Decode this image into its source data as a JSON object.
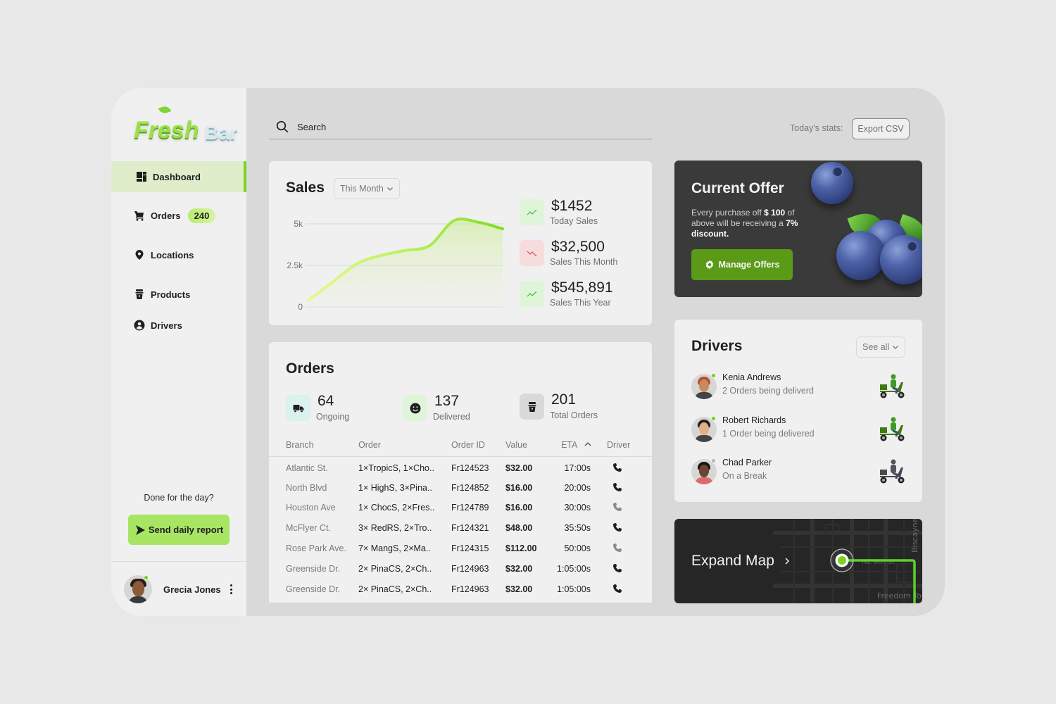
{
  "brand": {
    "name_part1": "Fresh",
    "name_part2": "Bar"
  },
  "sidebar": {
    "items": [
      {
        "label": "Dashboard",
        "icon": "dashboard-icon",
        "active": true
      },
      {
        "label": "Orders",
        "icon": "cart-icon",
        "badge": "240"
      },
      {
        "label": "Locations",
        "icon": "location-pin-icon"
      },
      {
        "label": "Products",
        "icon": "cup-icon"
      },
      {
        "label": "Drivers",
        "icon": "user-circle-icon"
      }
    ],
    "done_prompt": "Done for the day?",
    "send_report_label": "Send daily report",
    "user": {
      "name": "Grecia Jones",
      "status": "online"
    }
  },
  "topbar": {
    "search_placeholder": "Search",
    "stats_label": "Today's stats:",
    "export_label": "Export CSV"
  },
  "sales": {
    "title": "Sales",
    "period": "This Month",
    "kpis": [
      {
        "value": "$1452",
        "label": "Today Sales",
        "trend": "up"
      },
      {
        "value": "$32,500",
        "label": "Sales This Month",
        "trend": "down"
      },
      {
        "value": "$545,891",
        "label": "Sales This Year",
        "trend": "up"
      }
    ],
    "colors": {
      "up_bg": "#dff5d9",
      "up_line": "#3dbb3d",
      "down_bg": "#f6dcdc",
      "down_line": "#d84c4c",
      "line": "#8ee01f"
    }
  },
  "chart_data": {
    "type": "area",
    "title": "Sales",
    "xlabel": "",
    "ylabel": "",
    "ylim": [
      0,
      5000
    ],
    "yticks": [
      0,
      2500,
      5000
    ],
    "ytick_labels": [
      "0",
      "2.5k",
      "5k"
    ],
    "grid": true,
    "x": [
      0,
      1,
      2,
      3,
      4,
      5,
      6,
      7,
      8
    ],
    "values": [
      400,
      1500,
      2600,
      3100,
      3400,
      3700,
      5200,
      5100,
      4700
    ]
  },
  "offer": {
    "title": "Current Offer",
    "text_before": "Every purchase off ",
    "amount": "$ 100",
    "text_mid": " of above will be receiving a ",
    "discount": "7% discount.",
    "button_label": "Manage Offers"
  },
  "orders": {
    "title": "Orders",
    "stats": [
      {
        "value": "64",
        "label": "Ongoing",
        "icon": "truck-icon",
        "bg": "#d9f2ee"
      },
      {
        "value": "137",
        "label": "Delivered",
        "icon": "smiley-icon",
        "bg": "#dff5d9"
      },
      {
        "value": "201",
        "label": "Total Orders",
        "icon": "cup-icon",
        "bg": "#d9d9d9"
      }
    ],
    "columns": [
      "Branch",
      "Order",
      "Order ID",
      "Value",
      "ETA",
      "Driver"
    ],
    "sort_column": "ETA",
    "sort_direction": "ascending",
    "rows": [
      {
        "branch": "Atlantic St.",
        "order": "1×TropicS, 1×Cho..",
        "id": "Fr124523",
        "value": "$32.00",
        "eta": "17:00s",
        "driver_active": true
      },
      {
        "branch": "North Blvd",
        "order": "1× HighS, 3×Pina..",
        "id": "Fr124852",
        "value": "$16.00",
        "eta": "20:00s",
        "driver_active": true
      },
      {
        "branch": "Houston Ave",
        "order": "1× ChocS, 2×Fres..",
        "id": "Fr124789",
        "value": "$16.00",
        "eta": "30:00s",
        "driver_active": false
      },
      {
        "branch": "McFlyer Ct.",
        "order": "3× RedRS, 2×Tro..",
        "id": "Fr124321",
        "value": "$48.00",
        "eta": "35:50s",
        "driver_active": true
      },
      {
        "branch": "Rose Park Ave.",
        "order": "7× MangS, 2×Ma..",
        "id": "Fr124315",
        "value": "$112.00",
        "eta": "50:00s",
        "driver_active": false
      },
      {
        "branch": "Greenside Dr.",
        "order": "2× PinaCS, 2×Ch..",
        "id": "Fr124963",
        "value": "$32.00",
        "eta": "1:05:00s",
        "driver_active": true
      },
      {
        "branch": "Greenside Dr.",
        "order": "2× PinaCS, 2×Ch..",
        "id": "Fr124963",
        "value": "$32.00",
        "eta": "1:05:00s",
        "driver_active": true
      }
    ]
  },
  "drivers": {
    "title": "Drivers",
    "see_all_label": "See all",
    "list": [
      {
        "name": "Kenia Andrews",
        "status": "2 Orders being deliverd",
        "online": true,
        "scooter_color": "green"
      },
      {
        "name": "Robert Richards",
        "status": "1 Order  being delivered",
        "online": true,
        "scooter_color": "green"
      },
      {
        "name": "Chad Parker",
        "status": "On a Break",
        "online": false,
        "scooter_color": "gray"
      }
    ]
  },
  "map": {
    "label": "Expand Map",
    "street_labels": [
      "NE 8th St",
      "Biscayne",
      "Freedom Tower"
    ]
  }
}
